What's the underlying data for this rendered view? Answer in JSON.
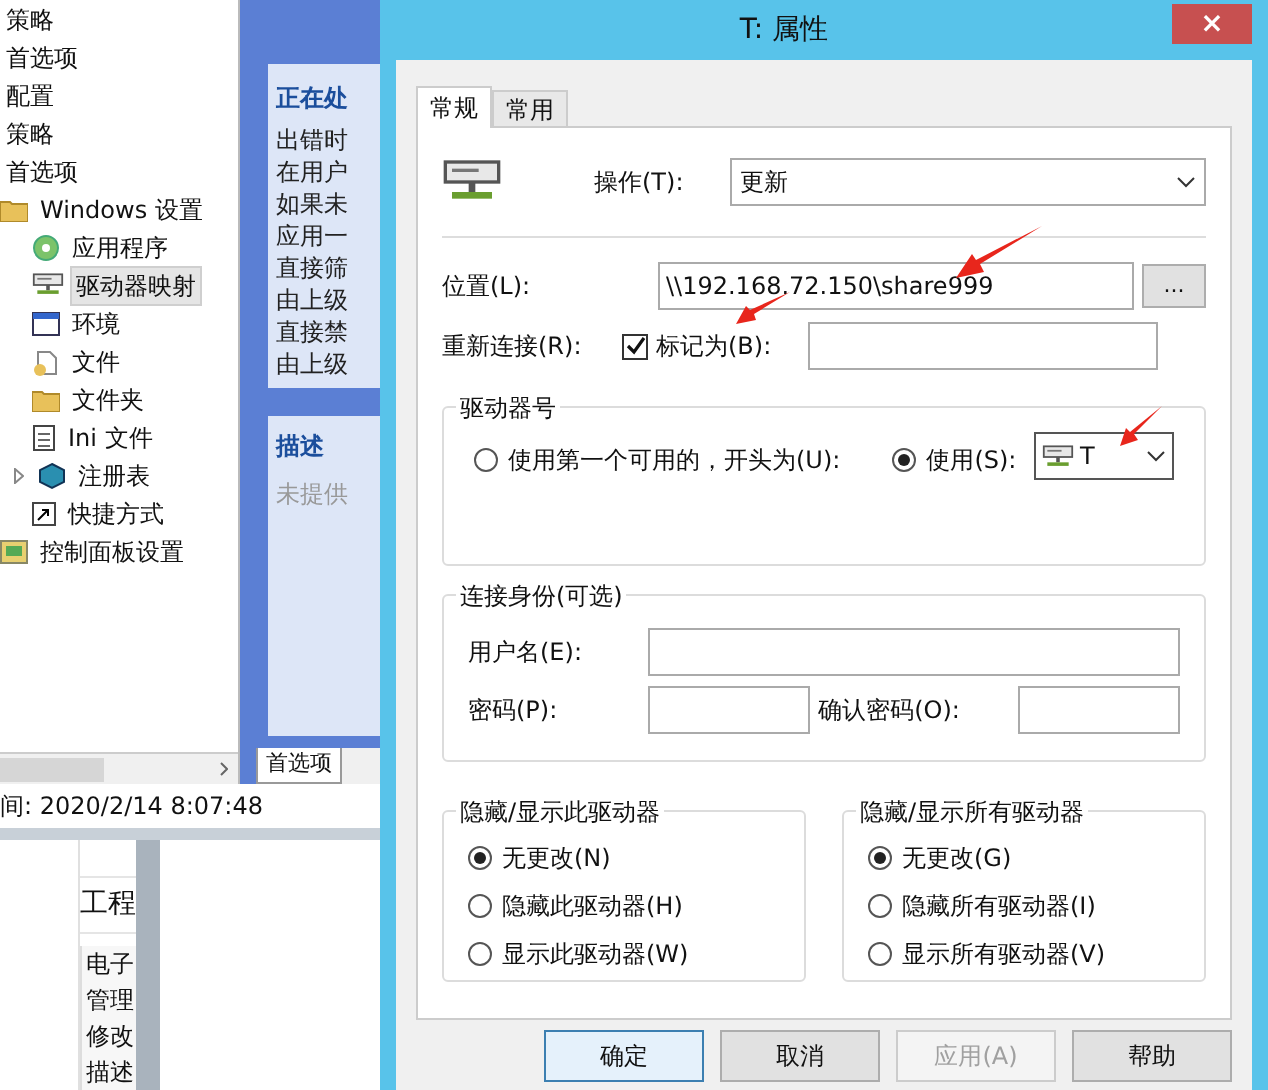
{
  "tree": [
    {
      "label": "策略",
      "selected": false
    },
    {
      "label": "首选项",
      "selected": false
    },
    {
      "label": "配置",
      "selected": false
    },
    {
      "label": "策略",
      "selected": false
    },
    {
      "label": "首选项",
      "selected": false
    },
    {
      "label": "Windows 设置",
      "selected": false,
      "kind": "folder",
      "children": [
        {
          "label": "应用程序",
          "selected": false,
          "kind": "app"
        },
        {
          "label": "驱动器映射",
          "selected": true,
          "kind": "drive"
        },
        {
          "label": "环境",
          "selected": false,
          "kind": "env"
        },
        {
          "label": "文件",
          "selected": false,
          "kind": "file"
        },
        {
          "label": "文件夹",
          "selected": false,
          "kind": "folder"
        },
        {
          "label": "Ini 文件",
          "selected": false,
          "kind": "ini"
        },
        {
          "label": "注册表",
          "selected": false,
          "kind": "registry",
          "expandable": true
        },
        {
          "label": "快捷方式",
          "selected": false,
          "kind": "shortcut"
        }
      ]
    },
    {
      "label": "控制面板设置",
      "selected": false,
      "kind": "panel"
    }
  ],
  "processing_card": {
    "heading": "正在处",
    "lines": [
      "出错时",
      "在用户",
      "如果未",
      "应用一",
      "直接筛",
      "由上级",
      "直接禁",
      "由上级"
    ]
  },
  "description_card": {
    "heading": "描述",
    "text": "未提供"
  },
  "bottom_tabs": [
    {
      "label": "首选项",
      "selected": true
    }
  ],
  "status_text": "间: 2020/2/14 8:07:48",
  "lower_list": {
    "header": "工程",
    "items": [
      "电子",
      "管理",
      "修改",
      "描述"
    ]
  },
  "dialog": {
    "title": "T: 属性",
    "close": "×",
    "tabs": [
      {
        "label": "常规",
        "selected": true
      },
      {
        "label": "常用",
        "selected": false
      }
    ],
    "action": {
      "label": "操作(T):",
      "value": "更新"
    },
    "location": {
      "label": "位置(L):",
      "value": "\\\\192.168.72.150\\share999",
      "browse": "..."
    },
    "reconnect": {
      "label": "重新连接(R):",
      "checked": true,
      "checkbox_label": "标记为(B):"
    },
    "drive": {
      "title": "驱动器号",
      "options": [
        {
          "label": "使用第一个可用的，开头为(U):",
          "selected": false
        },
        {
          "label": "使用(S):",
          "selected": true
        }
      ],
      "letter": "T"
    },
    "credentials": {
      "title": "连接身份(可选)",
      "username_label": "用户名(E):",
      "password_label": "密码(P):",
      "confirm_label": "确认密码(O):"
    },
    "hide_groups": [
      {
        "title": "隐藏/显示此驱动器",
        "options": [
          {
            "label": "无更改(N)",
            "selected": true
          },
          {
            "label": "隐藏此驱动器(H)",
            "selected": false
          },
          {
            "label": "显示此驱动器(W)",
            "selected": false
          }
        ]
      },
      {
        "title": "隐藏/显示所有驱动器",
        "options": [
          {
            "label": "无更改(G)",
            "selected": true
          },
          {
            "label": "隐藏所有驱动器(I)",
            "selected": false
          },
          {
            "label": "显示所有驱动器(V)",
            "selected": false
          }
        ]
      }
    ],
    "buttons": [
      {
        "label": "确定",
        "kind": "default",
        "disabled": false
      },
      {
        "label": "取消",
        "kind": "normal",
        "disabled": false
      },
      {
        "label": "应用(A)",
        "kind": "normal",
        "disabled": true
      },
      {
        "label": "帮助",
        "kind": "normal",
        "disabled": false
      }
    ]
  }
}
